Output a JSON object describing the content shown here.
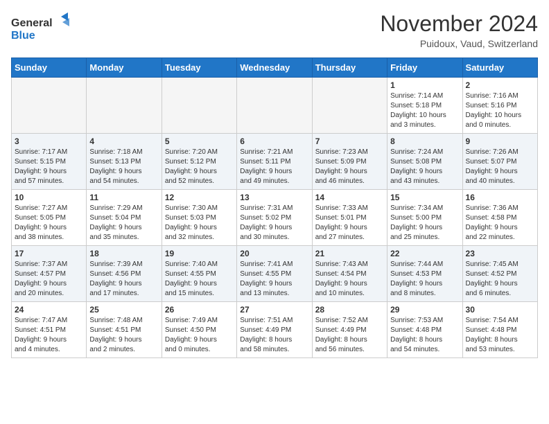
{
  "header": {
    "logo_general": "General",
    "logo_blue": "Blue",
    "month_title": "November 2024",
    "location": "Puidoux, Vaud, Switzerland"
  },
  "days_of_week": [
    "Sunday",
    "Monday",
    "Tuesday",
    "Wednesday",
    "Thursday",
    "Friday",
    "Saturday"
  ],
  "weeks": [
    [
      {
        "day": "",
        "info": ""
      },
      {
        "day": "",
        "info": ""
      },
      {
        "day": "",
        "info": ""
      },
      {
        "day": "",
        "info": ""
      },
      {
        "day": "",
        "info": ""
      },
      {
        "day": "1",
        "info": "Sunrise: 7:14 AM\nSunset: 5:18 PM\nDaylight: 10 hours\nand 3 minutes."
      },
      {
        "day": "2",
        "info": "Sunrise: 7:16 AM\nSunset: 5:16 PM\nDaylight: 10 hours\nand 0 minutes."
      }
    ],
    [
      {
        "day": "3",
        "info": "Sunrise: 7:17 AM\nSunset: 5:15 PM\nDaylight: 9 hours\nand 57 minutes."
      },
      {
        "day": "4",
        "info": "Sunrise: 7:18 AM\nSunset: 5:13 PM\nDaylight: 9 hours\nand 54 minutes."
      },
      {
        "day": "5",
        "info": "Sunrise: 7:20 AM\nSunset: 5:12 PM\nDaylight: 9 hours\nand 52 minutes."
      },
      {
        "day": "6",
        "info": "Sunrise: 7:21 AM\nSunset: 5:11 PM\nDaylight: 9 hours\nand 49 minutes."
      },
      {
        "day": "7",
        "info": "Sunrise: 7:23 AM\nSunset: 5:09 PM\nDaylight: 9 hours\nand 46 minutes."
      },
      {
        "day": "8",
        "info": "Sunrise: 7:24 AM\nSunset: 5:08 PM\nDaylight: 9 hours\nand 43 minutes."
      },
      {
        "day": "9",
        "info": "Sunrise: 7:26 AM\nSunset: 5:07 PM\nDaylight: 9 hours\nand 40 minutes."
      }
    ],
    [
      {
        "day": "10",
        "info": "Sunrise: 7:27 AM\nSunset: 5:05 PM\nDaylight: 9 hours\nand 38 minutes."
      },
      {
        "day": "11",
        "info": "Sunrise: 7:29 AM\nSunset: 5:04 PM\nDaylight: 9 hours\nand 35 minutes."
      },
      {
        "day": "12",
        "info": "Sunrise: 7:30 AM\nSunset: 5:03 PM\nDaylight: 9 hours\nand 32 minutes."
      },
      {
        "day": "13",
        "info": "Sunrise: 7:31 AM\nSunset: 5:02 PM\nDaylight: 9 hours\nand 30 minutes."
      },
      {
        "day": "14",
        "info": "Sunrise: 7:33 AM\nSunset: 5:01 PM\nDaylight: 9 hours\nand 27 minutes."
      },
      {
        "day": "15",
        "info": "Sunrise: 7:34 AM\nSunset: 5:00 PM\nDaylight: 9 hours\nand 25 minutes."
      },
      {
        "day": "16",
        "info": "Sunrise: 7:36 AM\nSunset: 4:58 PM\nDaylight: 9 hours\nand 22 minutes."
      }
    ],
    [
      {
        "day": "17",
        "info": "Sunrise: 7:37 AM\nSunset: 4:57 PM\nDaylight: 9 hours\nand 20 minutes."
      },
      {
        "day": "18",
        "info": "Sunrise: 7:39 AM\nSunset: 4:56 PM\nDaylight: 9 hours\nand 17 minutes."
      },
      {
        "day": "19",
        "info": "Sunrise: 7:40 AM\nSunset: 4:55 PM\nDaylight: 9 hours\nand 15 minutes."
      },
      {
        "day": "20",
        "info": "Sunrise: 7:41 AM\nSunset: 4:55 PM\nDaylight: 9 hours\nand 13 minutes."
      },
      {
        "day": "21",
        "info": "Sunrise: 7:43 AM\nSunset: 4:54 PM\nDaylight: 9 hours\nand 10 minutes."
      },
      {
        "day": "22",
        "info": "Sunrise: 7:44 AM\nSunset: 4:53 PM\nDaylight: 9 hours\nand 8 minutes."
      },
      {
        "day": "23",
        "info": "Sunrise: 7:45 AM\nSunset: 4:52 PM\nDaylight: 9 hours\nand 6 minutes."
      }
    ],
    [
      {
        "day": "24",
        "info": "Sunrise: 7:47 AM\nSunset: 4:51 PM\nDaylight: 9 hours\nand 4 minutes."
      },
      {
        "day": "25",
        "info": "Sunrise: 7:48 AM\nSunset: 4:51 PM\nDaylight: 9 hours\nand 2 minutes."
      },
      {
        "day": "26",
        "info": "Sunrise: 7:49 AM\nSunset: 4:50 PM\nDaylight: 9 hours\nand 0 minutes."
      },
      {
        "day": "27",
        "info": "Sunrise: 7:51 AM\nSunset: 4:49 PM\nDaylight: 8 hours\nand 58 minutes."
      },
      {
        "day": "28",
        "info": "Sunrise: 7:52 AM\nSunset: 4:49 PM\nDaylight: 8 hours\nand 56 minutes."
      },
      {
        "day": "29",
        "info": "Sunrise: 7:53 AM\nSunset: 4:48 PM\nDaylight: 8 hours\nand 54 minutes."
      },
      {
        "day": "30",
        "info": "Sunrise: 7:54 AM\nSunset: 4:48 PM\nDaylight: 8 hours\nand 53 minutes."
      }
    ]
  ]
}
